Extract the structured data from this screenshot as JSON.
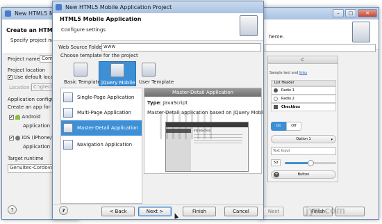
{
  "back_window": {
    "title": "New HTML5 M",
    "heading": "Create an HTML5",
    "subheading": "Specify project nam",
    "project_name_label": "Project name:",
    "project_name_value": "Comp",
    "project_location_label": "Project location",
    "use_default_label": "Use default locat",
    "location_label": "Location:",
    "location_value": "C:\\gtech\\",
    "app_config_label": "Application configu",
    "create_app_label": "Create an app for ea",
    "android_label": "Android",
    "android_sub": "Application n",
    "ios_label": "iOS (iPhone/i",
    "ios_sub": "Application n",
    "target_runtime_label": "Target runtime",
    "runtime_value": "Genuitec-Cordova 2"
  },
  "right_window": {
    "description_tail": "heme.",
    "finish_label": "Finish"
  },
  "phone_preview": {
    "header": "C",
    "sample_text": "Sample text and ",
    "sample_link": "links",
    "list_header": "List Header",
    "radio1": "Radio 1",
    "radio2": "Radio 2",
    "checkbox": "Checkbox",
    "toggle_on": "On",
    "toggle_off": "Off",
    "option": "Option 1",
    "text_input": "Text Input",
    "slider_value": "50",
    "slider_level": 0.5,
    "button": "Button"
  },
  "dialog": {
    "title": "New HTML5 Mobile Application Project",
    "heading": "HTML5 Mobile Application",
    "subheading": "Configure settings",
    "web_source_label": "Web Source Folder:",
    "web_source_value": "www",
    "choose_template_label": "Choose template for the project",
    "tabs": [
      {
        "label": "Basic Template"
      },
      {
        "label": "jQuery Mobile"
      },
      {
        "label": "User Template"
      }
    ],
    "templates": [
      {
        "label": "Single-Page Application"
      },
      {
        "label": "Multi-Page Application"
      },
      {
        "label": "Master-Detail Application"
      },
      {
        "label": "Navigation Application"
      }
    ],
    "detail": {
      "title": "Master-Detail Application",
      "type_label": "Type",
      "type_value": ": JavaScript",
      "description": "Master-Detail application based on jQuery Mobile",
      "preview_intro": "Introduction"
    },
    "buttons": {
      "help": "?",
      "back": "< Back",
      "next": "Next >",
      "finish": "Finish",
      "cancel": "Cancel"
    },
    "ghost_next": "Next"
  },
  "watermark": "jyn.com"
}
